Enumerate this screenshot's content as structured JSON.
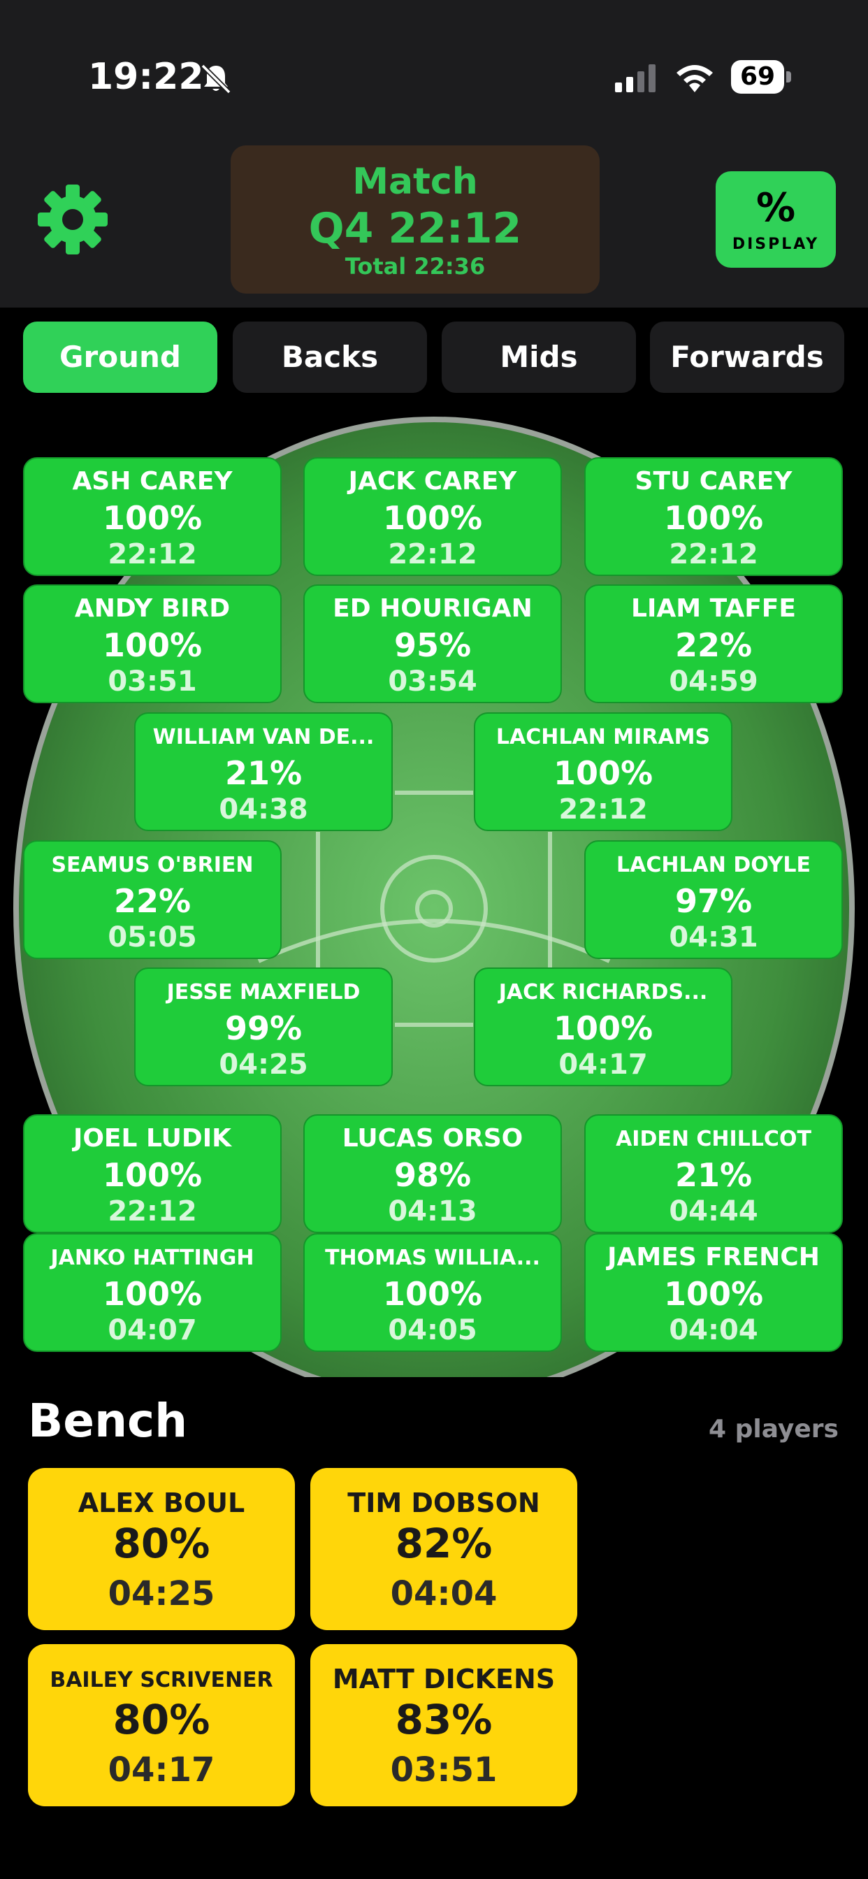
{
  "status_bar": {
    "time": "19:22",
    "battery": "69"
  },
  "header": {
    "match_label": "Match",
    "match_clock": "Q4 22:12",
    "total": "Total 22:36",
    "display_symbol": "%",
    "display_label": "DISPLAY"
  },
  "tabs": [
    {
      "label": "Ground",
      "active": true
    },
    {
      "label": "Backs",
      "active": false
    },
    {
      "label": "Mids",
      "active": false
    },
    {
      "label": "Forwards",
      "active": false
    }
  ],
  "players": [
    {
      "name": "ASH CAREY",
      "pct": "100%",
      "time": "22:12"
    },
    {
      "name": "JACK CAREY",
      "pct": "100%",
      "time": "22:12"
    },
    {
      "name": "STU CAREY",
      "pct": "100%",
      "time": "22:12"
    },
    {
      "name": "ANDY BIRD",
      "pct": "100%",
      "time": "03:51"
    },
    {
      "name": "ED HOURIGAN",
      "pct": "95%",
      "time": "03:54"
    },
    {
      "name": "LIAM TAFFE",
      "pct": "22%",
      "time": "04:59"
    },
    {
      "name": "WILLIAM VAN DE...",
      "pct": "21%",
      "time": "04:38"
    },
    {
      "name": "LACHLAN MIRAMS",
      "pct": "100%",
      "time": "22:12"
    },
    {
      "name": "SEAMUS O'BRIEN",
      "pct": "22%",
      "time": "05:05"
    },
    {
      "name": "LACHLAN DOYLE",
      "pct": "97%",
      "time": "04:31"
    },
    {
      "name": "JESSE MAXFIELD",
      "pct": "99%",
      "time": "04:25"
    },
    {
      "name": "JACK RICHARDS...",
      "pct": "100%",
      "time": "04:17"
    },
    {
      "name": "JOEL LUDIK",
      "pct": "100%",
      "time": "22:12"
    },
    {
      "name": "LUCAS ORSO",
      "pct": "98%",
      "time": "04:13"
    },
    {
      "name": "AIDEN CHILLCOT",
      "pct": "21%",
      "time": "04:44"
    },
    {
      "name": "JANKO HATTINGH",
      "pct": "100%",
      "time": "04:07"
    },
    {
      "name": "THOMAS WILLIA...",
      "pct": "100%",
      "time": "04:05"
    },
    {
      "name": "JAMES FRENCH",
      "pct": "100%",
      "time": "04:04"
    }
  ],
  "bench": {
    "title": "Bench",
    "count": "4 players",
    "players": [
      {
        "name": "ALEX BOUL",
        "pct": "80%",
        "time": "04:25"
      },
      {
        "name": "TIM DOBSON",
        "pct": "82%",
        "time": "04:04"
      },
      {
        "name": "BAILEY SCRIVENER",
        "pct": "80%",
        "time": "04:17"
      },
      {
        "name": "MATT DICKENS",
        "pct": "83%",
        "time": "03:51"
      }
    ]
  },
  "colors": {
    "accent_green": "#30d158",
    "card_green": "#1fcc3a",
    "bench_yellow": "#ffd60a",
    "header_bg": "#1c1c1e",
    "match_card_bg": "#3a2a1e"
  },
  "icons": [
    "bell-slash-icon",
    "signal-icon",
    "wifi-icon",
    "battery-icon",
    "gear-icon"
  ]
}
